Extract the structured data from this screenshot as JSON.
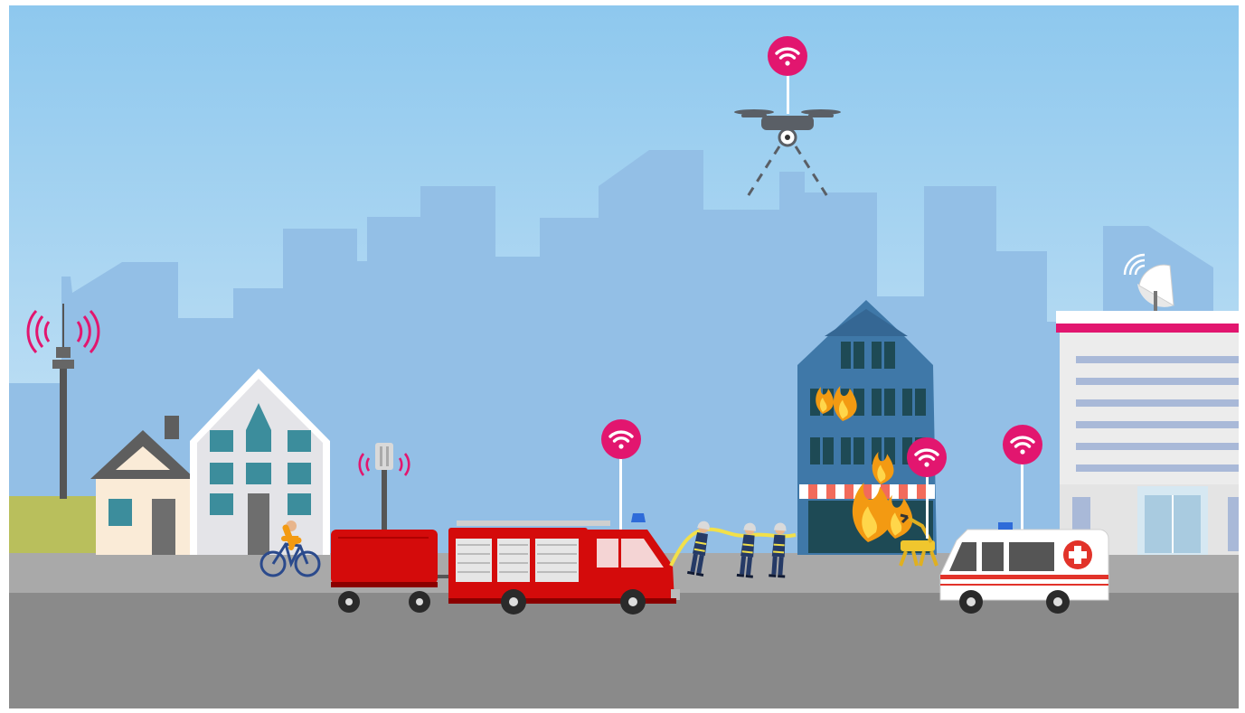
{
  "scene": {
    "palette": {
      "sky_top": "#8ec8ee",
      "sky_bottom": "#dcedf8",
      "skyline": "#93bfe6",
      "sidewalk": "#a9a9a9",
      "road": "#8a8a8a",
      "grass": "#b9bf5c",
      "wifi_badge": "#e2166f",
      "fire_red": "#d40b0b",
      "building_blue": "#3f78a8",
      "firefighter_navy": "#253a66",
      "flame_orange": "#f39a12",
      "hose_yellow": "#f2e04a"
    },
    "icons": [
      "wifi-icon",
      "drone-icon",
      "radio-tower-icon",
      "small-cell-antenna-icon",
      "satellite-dish-icon",
      "fire-truck-icon",
      "ambulance-icon",
      "firefighter-icon",
      "robot-dog-icon",
      "bicycle-icon",
      "flame-icon",
      "house-icon",
      "hospital-icon",
      "medical-cross-icon",
      "siren-icon"
    ]
  }
}
